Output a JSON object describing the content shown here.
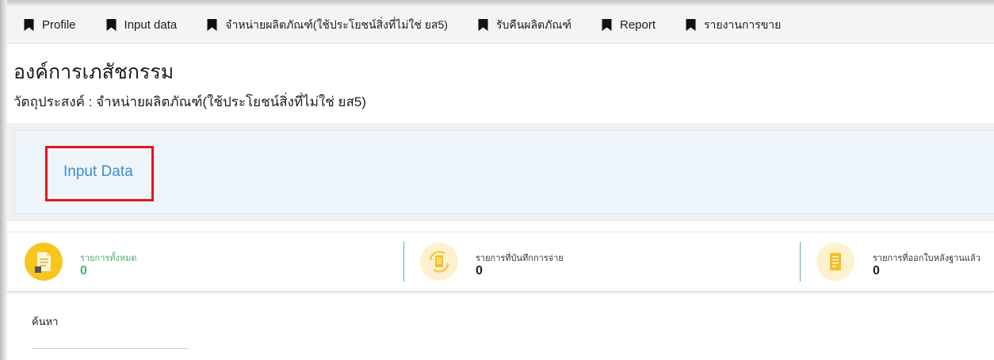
{
  "nav": {
    "items": [
      {
        "label": "Profile",
        "icon": "bookmark-icon"
      },
      {
        "label": "Input data",
        "icon": "bookmark-icon"
      },
      {
        "label": "จำหน่ายผลิตภัณฑ์(ใช้ประโยชน์สิ่งที่ไม่ใช่ ยส5)",
        "icon": "bookmark-icon"
      },
      {
        "label": "รับคืนผลิตภัณฑ์",
        "icon": "bookmark-icon"
      },
      {
        "label": "Report",
        "icon": "bookmark-icon"
      },
      {
        "label": "รายงานการขาย",
        "icon": "bookmark-icon"
      }
    ]
  },
  "header": {
    "org_title": "องค์การเภสัชกรรม",
    "objective": "วัตถุประสงค์ : จำหน่ายผลิตภัณฑ์(ใช้ประโยชน์สิ่งที่ไม่ใช่ ยส5)"
  },
  "panel": {
    "input_data_label": "Input Data",
    "highlight_color": "#e8141c",
    "link_color": "#3b8fd0"
  },
  "stats": [
    {
      "label": "รายการทั้งหมด",
      "value": "0",
      "icon": "document-icon",
      "label_color": "#4caf6e",
      "value_color": "#4caf6e"
    },
    {
      "label": "รายการที่บันทึกการจ่าย",
      "value": "0",
      "icon": "refresh-document-icon",
      "label_color": "#333333",
      "value_color": "#222222"
    },
    {
      "label": "รายการที่ออกใบหลังฐานแล้ว",
      "value": "0",
      "icon": "receipt-icon",
      "label_color": "#333333",
      "value_color": "#222222"
    }
  ],
  "search": {
    "label": "ค้นหา",
    "value": "",
    "placeholder": ""
  }
}
